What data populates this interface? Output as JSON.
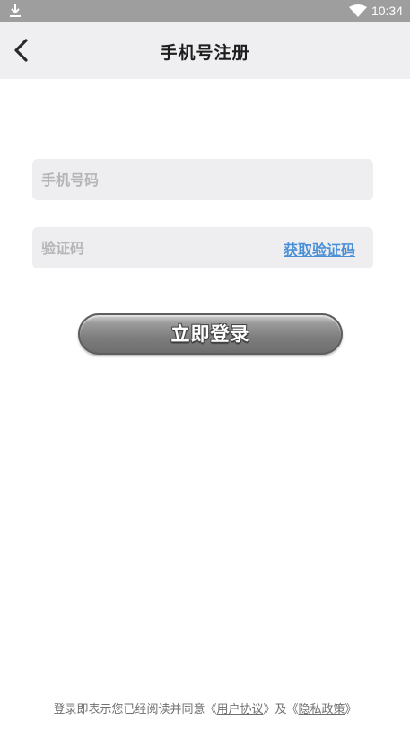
{
  "status_bar": {
    "time": "10:34",
    "icons": [
      "download-icon",
      "wifi-icon"
    ]
  },
  "header": {
    "title": "手机号注册",
    "back_icon": "chevron-left-icon"
  },
  "form": {
    "phone_placeholder": "手机号码",
    "phone_value": "",
    "code_placeholder": "验证码",
    "code_value": "",
    "get_code_label": "获取验证码"
  },
  "login": {
    "label": "立即登录"
  },
  "agreement": {
    "prefix": "登录即表示您已经阅读并同意",
    "open_quote_1": "《",
    "user_agreement": "用户协议",
    "close_quote_1": "》",
    "and": "及",
    "open_quote_2": "《",
    "privacy_policy": "隐私政策",
    "close_quote_2": "》"
  },
  "colors": {
    "status_bar": "#9e9e9e",
    "header_bg": "#efeff1",
    "input_bg": "#eeeef0",
    "link_blue": "#4a90d6",
    "button_gray": "#7d7d7d"
  }
}
